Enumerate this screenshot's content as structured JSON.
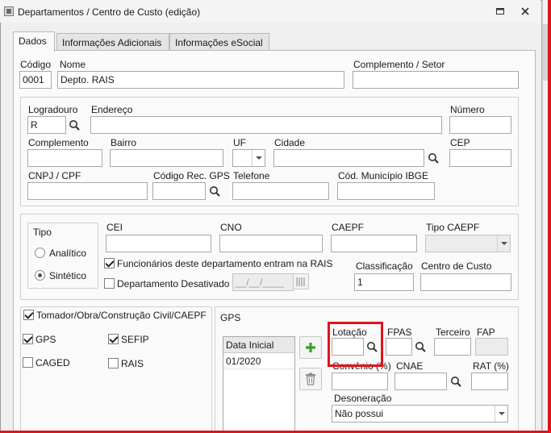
{
  "window": {
    "title": "Departamentos / Centro de Custo (edição)"
  },
  "tabs": [
    "Dados",
    "Informações Adicionais",
    "Informações eSocial"
  ],
  "ident": {
    "codigo_label": "Código",
    "codigo_value": "0001",
    "nome_label": "Nome",
    "nome_value": "Depto. RAIS",
    "complemento_setor_label": "Complemento / Setor",
    "complemento_setor_value": ""
  },
  "endereco": {
    "logradouro_label": "Logradouro",
    "logradouro_value": "R",
    "endereco_label": "Endereço",
    "endereco_value": "",
    "numero_label": "Número",
    "numero_value": "",
    "complemento_label": "Complemento",
    "complemento_value": "",
    "bairro_label": "Bairro",
    "bairro_value": "",
    "uf_label": "UF",
    "uf_value": "",
    "cidade_label": "Cidade",
    "cidade_value": "",
    "cep_label": "CEP",
    "cep_value": "",
    "cnpj_label": "CNPJ / CPF",
    "cnpj_value": "",
    "codrec_label": "Código Rec. GPS",
    "codrec_value": "",
    "telefone_label": "Telefone",
    "telefone_value": "",
    "ibge_label": "Cód. Município IBGE",
    "ibge_value": ""
  },
  "tipo": {
    "group_label": "Tipo",
    "options": [
      "Analítico",
      "Sintético"
    ],
    "selected": "Sintético",
    "cei_label": "CEI",
    "cei_value": "",
    "cno_label": "CNO",
    "cno_value": "",
    "caepf_label": "CAEPF",
    "caepf_value": "",
    "tipo_caepf_label": "Tipo CAEPF",
    "tipo_caepf_value": "",
    "func_rais_label": "Funcionários deste departamento entram na RAIS",
    "classificacao_label": "Classificação",
    "classificacao_value": "1",
    "centro_custo_label": "Centro de Custo",
    "centro_custo_value": "",
    "desativado_label": "Departamento Desativado",
    "desativado_date": "__/__/____"
  },
  "obrigacoes": {
    "tomador_label": "Tomador/Obra/Construção Civil/CAEPF",
    "gps_label": "GPS",
    "sefip_label": "SEFIP",
    "caged_label": "CAGED",
    "rais_label": "RAIS"
  },
  "gps": {
    "group_label": "GPS",
    "grid_header": "Data Inicial",
    "grid_rows": [
      "01/2020"
    ],
    "lotacao_label": "Lotação",
    "lotacao_value": "",
    "fpas_label": "FPAS",
    "fpas_value": "",
    "terceiro_label": "Terceiro",
    "terceiro_value": "",
    "fap_label": "FAP",
    "fap_value": "",
    "convenio_label": "Convênio (%)",
    "convenio_value": "",
    "cnae_label": "CNAE",
    "cnae_value": "",
    "rat_label": "RAT (%)",
    "rat_value": "",
    "desoneracao_label": "Desoneração",
    "desoneracao_value": "Não possui"
  },
  "colors": {
    "highlight": "#e0141b",
    "add_green": "#3aa028"
  }
}
